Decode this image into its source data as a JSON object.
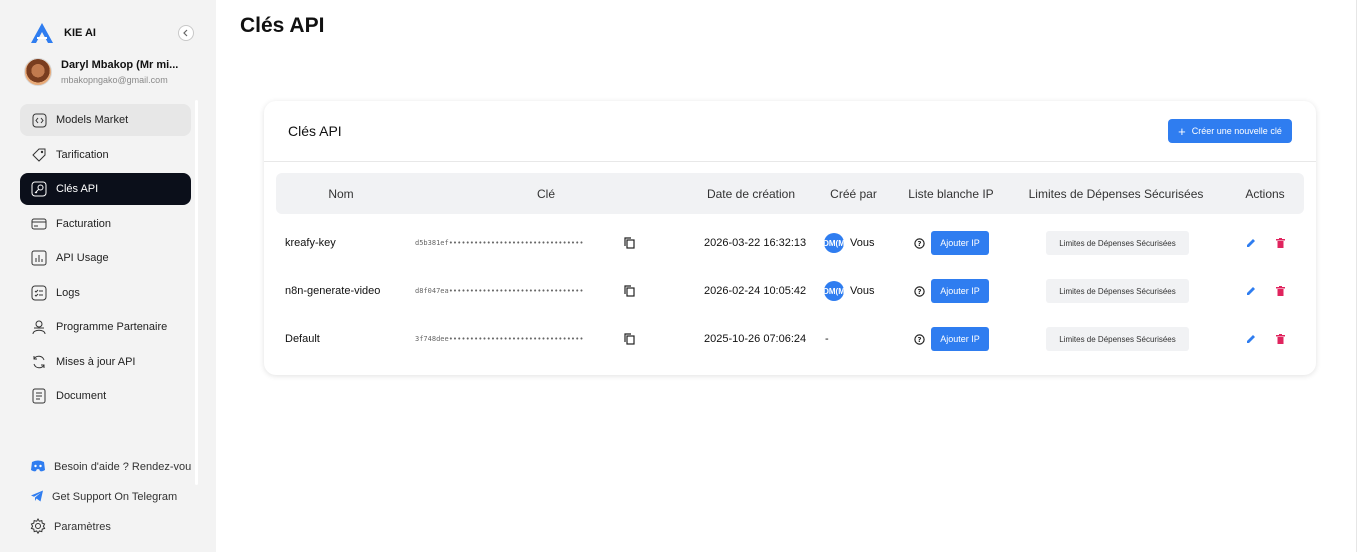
{
  "brand": {
    "name": "KIE AI"
  },
  "user": {
    "name": "Daryl Mbakop (Mr mi...",
    "email": "mbakopngako@gmail.com"
  },
  "sidebar": {
    "items": [
      {
        "label": "Models Market",
        "icon": "code-icon"
      },
      {
        "label": "Tarification",
        "icon": "price-tag-icon"
      },
      {
        "label": "Clés API",
        "icon": "key-icon"
      },
      {
        "label": "Facturation",
        "icon": "billing-icon"
      },
      {
        "label": "API Usage",
        "icon": "bar-chart-icon"
      },
      {
        "label": "Logs",
        "icon": "logs-icon"
      },
      {
        "label": "Programme Partenaire",
        "icon": "partner-icon"
      },
      {
        "label": "Mises à jour API",
        "icon": "refresh-icon"
      },
      {
        "label": "Document",
        "icon": "document-icon"
      }
    ],
    "footer": [
      {
        "label": "Besoin d'aide ? Rendez-vou",
        "icon": "discord-icon"
      },
      {
        "label": "Get Support On Telegram",
        "icon": "telegram-icon"
      },
      {
        "label": "Paramètres",
        "icon": "gear-icon"
      }
    ]
  },
  "page": {
    "title": "Clés API"
  },
  "card": {
    "title": "Clés API",
    "create_label": "Créer une nouvelle clé"
  },
  "table": {
    "headers": {
      "name": "Nom",
      "key": "Clé",
      "created": "Date de création",
      "creator": "Créé par",
      "whitelist": "Liste blanche IP",
      "limits": "Limites de Dépenses Sécurisées",
      "actions": "Actions"
    },
    "rows": [
      {
        "name": "kreafy-key",
        "key": "d5b381ef••••••••••••••••••••••••••••••••",
        "created": "2026-03-22 16:32:13",
        "creator_badge": "DM(M",
        "creator": "Vous",
        "ip_button": "Ajouter IP",
        "limit_button": "Limites de Dépenses Sécurisées"
      },
      {
        "name": "n8n-generate-video",
        "key": "d8f047ea••••••••••••••••••••••••••••••••",
        "created": "2026-02-24 10:05:42",
        "creator_badge": "DM(M",
        "creator": "Vous",
        "ip_button": "Ajouter IP",
        "limit_button": "Limites de Dépenses Sécurisées"
      },
      {
        "name": "Default",
        "key": "3f748dee••••••••••••••••••••••••••••••••",
        "created": "2025-10-26 07:06:24",
        "creator_badge": "",
        "creator": "-",
        "ip_button": "Ajouter IP",
        "limit_button": "Limites de Dépenses Sécurisées"
      }
    ]
  },
  "colors": {
    "accent": "#2f7df0",
    "delete": "#e0245e",
    "active_nav": "#0b0f1a"
  }
}
